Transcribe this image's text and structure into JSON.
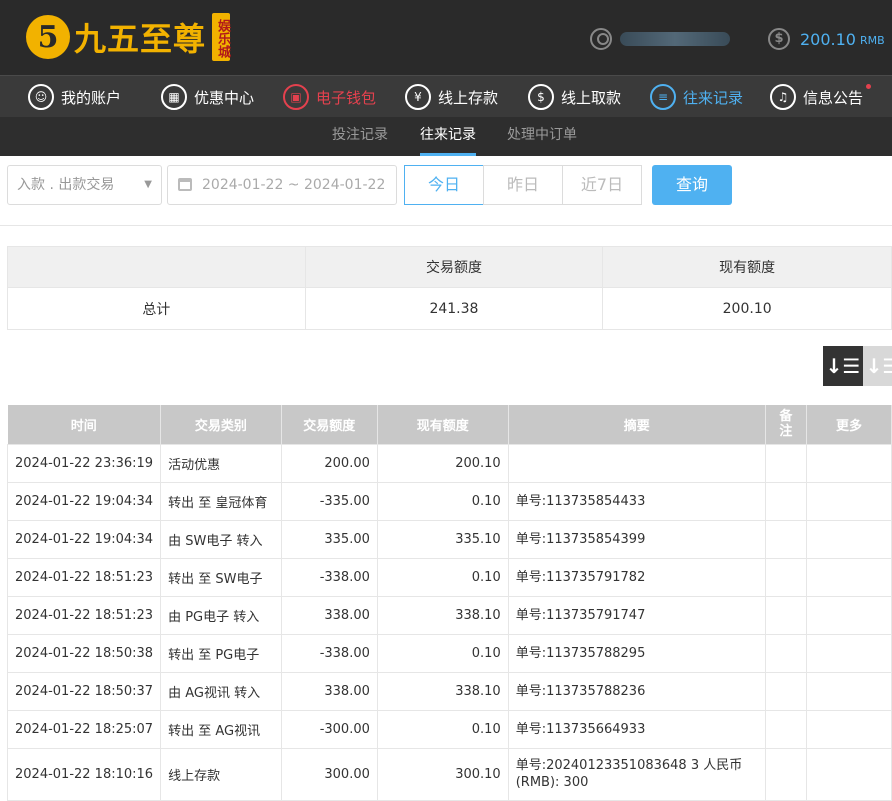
{
  "brand": {
    "logo_mark": "5",
    "name": "九五至尊",
    "badge": "娱乐城"
  },
  "account": {
    "balance": "200.10",
    "currency": "RMB"
  },
  "nav": [
    {
      "label": "我的账户",
      "icon": "user-circle-icon",
      "glyph": "☺",
      "state": "normal"
    },
    {
      "label": "优惠中心",
      "icon": "gift-icon",
      "glyph": "▦",
      "state": "normal"
    },
    {
      "label": "电子钱包",
      "icon": "wallet-icon",
      "glyph": "▣",
      "state": "red"
    },
    {
      "label": "线上存款",
      "icon": "deposit-icon",
      "glyph": "¥",
      "state": "normal"
    },
    {
      "label": "线上取款",
      "icon": "withdraw-icon",
      "glyph": "$",
      "state": "normal"
    },
    {
      "label": "往来记录",
      "icon": "records-icon",
      "glyph": "≡",
      "state": "blue"
    },
    {
      "label": "信息公告",
      "icon": "bell-icon",
      "glyph": "♫",
      "state": "normal"
    }
  ],
  "subnav": [
    {
      "label": "投注记录",
      "active": false
    },
    {
      "label": "往来记录",
      "active": true
    },
    {
      "label": "处理中订单",
      "active": false
    }
  ],
  "filter": {
    "type_placeholder": "入款 . 出款交易",
    "date_range": "2024-01-22 ~ 2024-01-22",
    "quick": [
      "今日",
      "昨日",
      "近7日"
    ],
    "quick_active": "今日",
    "query_label": "查询"
  },
  "summary": {
    "headers": [
      "",
      "交易额度",
      "现有额度"
    ],
    "row": [
      "总计",
      "241.38",
      "200.10"
    ]
  },
  "table": {
    "headers": [
      "时间",
      "交易类别",
      "交易额度",
      "现有额度",
      "摘要",
      "备注",
      "更多"
    ],
    "rows": [
      [
        "2024-01-22 23:36:19",
        "活动优惠",
        "200.00",
        "200.10",
        "",
        "",
        ""
      ],
      [
        "2024-01-22 19:04:34",
        "转出 至 皇冠体育",
        "-335.00",
        "0.10",
        "单号:113735854433",
        "",
        ""
      ],
      [
        "2024-01-22 19:04:34",
        "由 SW电子 转入",
        "335.00",
        "335.10",
        "单号:113735854399",
        "",
        ""
      ],
      [
        "2024-01-22 18:51:23",
        "转出 至 SW电子",
        "-338.00",
        "0.10",
        "单号:113735791782",
        "",
        ""
      ],
      [
        "2024-01-22 18:51:23",
        "由 PG电子 转入",
        "338.00",
        "338.10",
        "单号:113735791747",
        "",
        ""
      ],
      [
        "2024-01-22 18:50:38",
        "转出 至 PG电子",
        "-338.00",
        "0.10",
        "单号:113735788295",
        "",
        ""
      ],
      [
        "2024-01-22 18:50:37",
        "由 AG视讯 转入",
        "338.00",
        "338.10",
        "单号:113735788236",
        "",
        ""
      ],
      [
        "2024-01-22 18:25:07",
        "转出 至 AG视讯",
        "-300.00",
        "0.10",
        "单号:113735664933",
        "",
        ""
      ],
      [
        "2024-01-22 18:10:16",
        "线上存款",
        "300.00",
        "300.10",
        "单号:20240123351083648 3 人民币(RMB): 300",
        "",
        ""
      ]
    ]
  },
  "colors": {
    "accent_blue": "#4fb1f1",
    "accent_red": "#e4414e",
    "brand_gold": "#f2b200",
    "header_bg": "#2a2a2a"
  }
}
